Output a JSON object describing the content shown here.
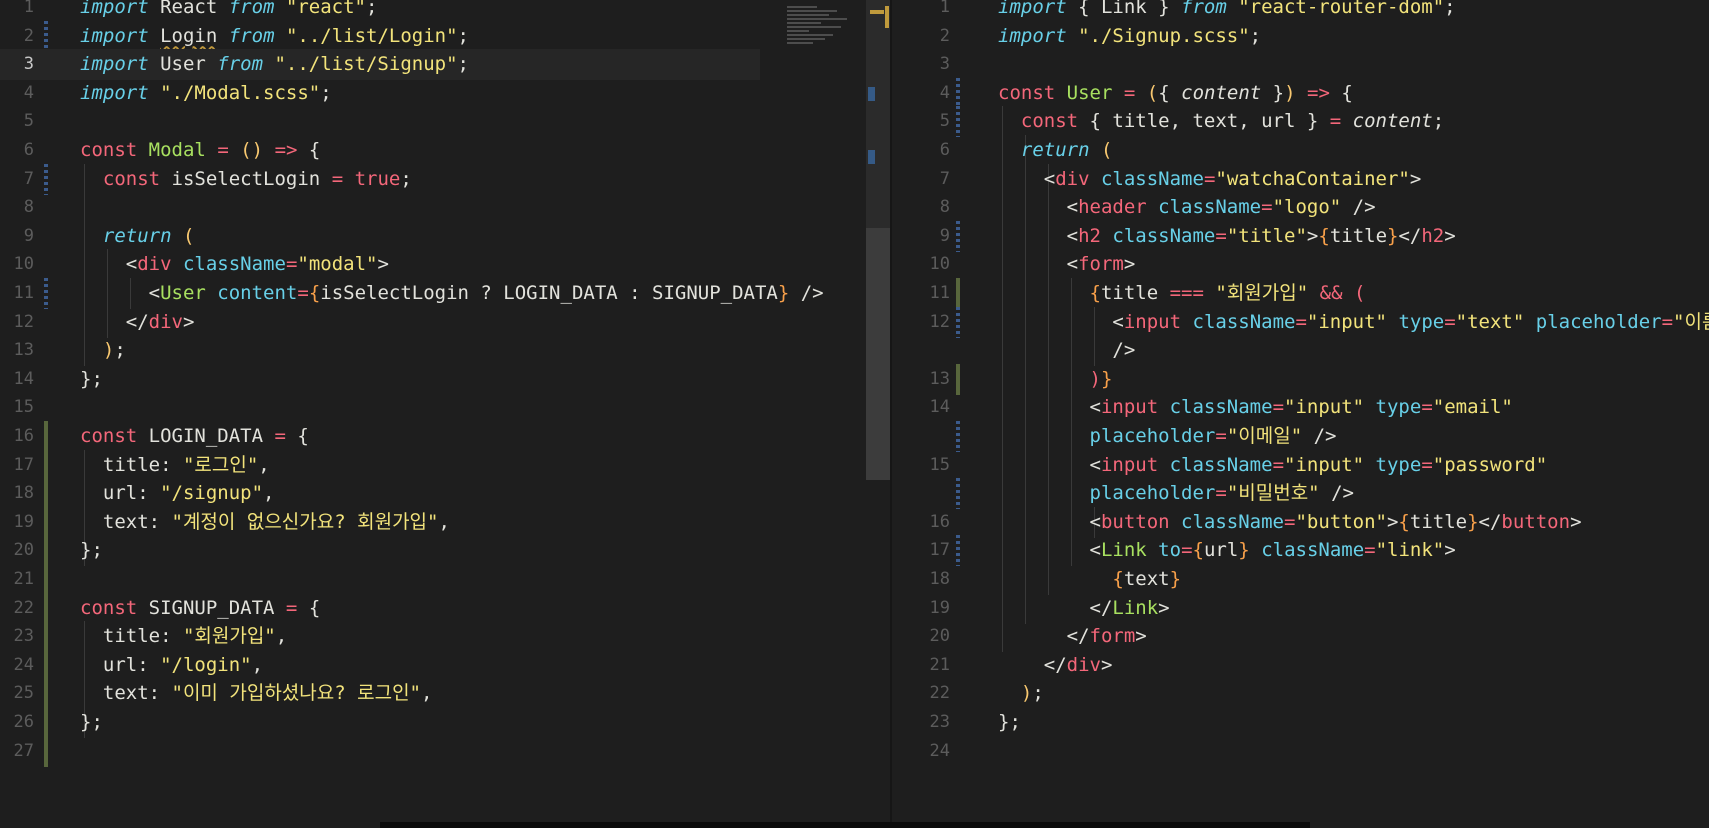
{
  "theme": {
    "keyword": "#f4677a",
    "italic_keyword": "#68d0e8",
    "string": "#f2e37b",
    "func": "#a8e060",
    "tag": "#f4677a",
    "attr": "#68d0e8",
    "paren": "#f8c870",
    "brace": "#f8a04a",
    "operator": "#f4677a",
    "plain": "#e2e2dc",
    "comment": "#6c6c6c"
  },
  "left_editor": {
    "lines": [
      {
        "n": "1",
        "tokens": [
          [
            "kwi",
            "import"
          ],
          [
            "p",
            " React "
          ],
          [
            "kwi",
            "from"
          ],
          [
            "s",
            " \"react\""
          ],
          [
            "p",
            ";"
          ]
        ]
      },
      {
        "n": "2",
        "tokens": [
          [
            "kwi",
            "import"
          ],
          [
            "p",
            " "
          ],
          [
            "sq",
            "Login"
          ],
          [
            "p",
            " "
          ],
          [
            "kwi",
            "from"
          ],
          [
            "s",
            " \"../list/Login\""
          ],
          [
            "p",
            ";"
          ]
        ]
      },
      {
        "n": "3",
        "tokens": [
          [
            "kwi",
            "import"
          ],
          [
            "p",
            " User "
          ],
          [
            "kwi",
            "from"
          ],
          [
            "s",
            " \"../list/Signup\""
          ],
          [
            "p",
            ";"
          ]
        ]
      },
      {
        "n": "4",
        "tokens": [
          [
            "kwi",
            "import"
          ],
          [
            "s",
            " \"./Modal.scss\""
          ],
          [
            "p",
            ";"
          ]
        ]
      },
      {
        "n": "5",
        "tokens": []
      },
      {
        "n": "6",
        "tokens": [
          [
            "kw",
            "const"
          ],
          [
            "p",
            " "
          ],
          [
            "fn",
            "Modal"
          ],
          [
            "p",
            " "
          ],
          [
            "op",
            "="
          ],
          [
            "p",
            " "
          ],
          [
            "par",
            "()"
          ],
          [
            "p",
            " "
          ],
          [
            "op",
            "=>"
          ],
          [
            "p",
            " {"
          ]
        ]
      },
      {
        "n": "7",
        "tokens": [
          [
            "p",
            "  "
          ],
          [
            "kw",
            "const"
          ],
          [
            "p",
            " isSelectLogin "
          ],
          [
            "op",
            "="
          ],
          [
            "p",
            " "
          ],
          [
            "kw",
            "true"
          ],
          [
            "p",
            ";"
          ]
        ]
      },
      {
        "n": "8",
        "tokens": []
      },
      {
        "n": "9",
        "tokens": [
          [
            "p",
            "  "
          ],
          [
            "kwi",
            "return"
          ],
          [
            "p",
            " "
          ],
          [
            "par",
            "("
          ]
        ]
      },
      {
        "n": "10",
        "tokens": [
          [
            "p",
            "    <"
          ],
          [
            "tag",
            "div"
          ],
          [
            "p",
            " "
          ],
          [
            "at",
            "className"
          ],
          [
            "op",
            "="
          ],
          [
            "s",
            "\"modal\""
          ],
          [
            "p",
            ">"
          ]
        ]
      },
      {
        "n": "11",
        "tokens": [
          [
            "p",
            "      <"
          ],
          [
            "fn",
            "User"
          ],
          [
            "p",
            " "
          ],
          [
            "at",
            "content"
          ],
          [
            "op",
            "="
          ],
          [
            "br",
            "{"
          ],
          [
            "p",
            "isSelectLogin ? LOGIN_DATA : SIGNUP_DATA"
          ],
          [
            "br",
            "}"
          ],
          [
            "p",
            " />"
          ]
        ]
      },
      {
        "n": "12",
        "tokens": [
          [
            "p",
            "    </"
          ],
          [
            "tag",
            "div"
          ],
          [
            "p",
            ">"
          ]
        ]
      },
      {
        "n": "13",
        "tokens": [
          [
            "p",
            "  "
          ],
          [
            "par",
            ")"
          ],
          [
            "p",
            ";"
          ]
        ]
      },
      {
        "n": "14",
        "tokens": [
          [
            "p",
            "};"
          ]
        ]
      },
      {
        "n": "15",
        "tokens": []
      },
      {
        "n": "16",
        "tokens": [
          [
            "kw",
            "const"
          ],
          [
            "p",
            " LOGIN_DATA "
          ],
          [
            "op",
            "="
          ],
          [
            "p",
            " {"
          ]
        ]
      },
      {
        "n": "17",
        "tokens": [
          [
            "p",
            "  title: "
          ],
          [
            "s",
            "\"로그인\""
          ],
          [
            "p",
            ","
          ]
        ]
      },
      {
        "n": "18",
        "tokens": [
          [
            "p",
            "  url: "
          ],
          [
            "s",
            "\"/signup\""
          ],
          [
            "p",
            ","
          ]
        ]
      },
      {
        "n": "19",
        "tokens": [
          [
            "p",
            "  text: "
          ],
          [
            "s",
            "\"계정이 없으신가요? 회원가입\""
          ],
          [
            "p",
            ","
          ]
        ]
      },
      {
        "n": "20",
        "tokens": [
          [
            "p",
            "};"
          ]
        ]
      },
      {
        "n": "21",
        "tokens": []
      },
      {
        "n": "22",
        "tokens": [
          [
            "kw",
            "const"
          ],
          [
            "p",
            " SIGNUP_DATA "
          ],
          [
            "op",
            "="
          ],
          [
            "p",
            " {"
          ]
        ]
      },
      {
        "n": "23",
        "tokens": [
          [
            "p",
            "  title: "
          ],
          [
            "s",
            "\"회원가입\""
          ],
          [
            "p",
            ","
          ]
        ]
      },
      {
        "n": "24",
        "tokens": [
          [
            "p",
            "  url: "
          ],
          [
            "s",
            "\"/login\""
          ],
          [
            "p",
            ","
          ]
        ]
      },
      {
        "n": "25",
        "tokens": [
          [
            "p",
            "  text: "
          ],
          [
            "s",
            "\"이미 가입하셨나요? 로그인\""
          ],
          [
            "p",
            ","
          ]
        ]
      },
      {
        "n": "26",
        "tokens": [
          [
            "p",
            "};"
          ]
        ]
      },
      {
        "n": "27",
        "tokens": []
      }
    ]
  },
  "right_editor": {
    "lines": [
      {
        "n": "1",
        "tokens": [
          [
            "kwi",
            "import"
          ],
          [
            "p",
            " { Link } "
          ],
          [
            "kwi",
            "from"
          ],
          [
            "s",
            " \"react-router-dom\""
          ],
          [
            "p",
            ";"
          ]
        ]
      },
      {
        "n": "2",
        "tokens": [
          [
            "kwi",
            "import"
          ],
          [
            "s",
            " \"./Signup.scss\""
          ],
          [
            "p",
            ";"
          ]
        ]
      },
      {
        "n": "3",
        "tokens": []
      },
      {
        "n": "4",
        "tokens": [
          [
            "kw",
            "const"
          ],
          [
            "p",
            " "
          ],
          [
            "fn",
            "User"
          ],
          [
            "p",
            " "
          ],
          [
            "op",
            "="
          ],
          [
            "p",
            " "
          ],
          [
            "par",
            "("
          ],
          [
            "p",
            "{ "
          ],
          [
            "it",
            "content"
          ],
          [
            "p",
            " }"
          ],
          [
            "par",
            ")"
          ],
          [
            "p",
            " "
          ],
          [
            "op",
            "=>"
          ],
          [
            "p",
            " {"
          ]
        ]
      },
      {
        "n": "5",
        "tokens": [
          [
            "p",
            "  "
          ],
          [
            "kw",
            "const"
          ],
          [
            "p",
            " { title, text, url } "
          ],
          [
            "op",
            "="
          ],
          [
            "p",
            " "
          ],
          [
            "it",
            "content"
          ],
          [
            "p",
            ";"
          ]
        ]
      },
      {
        "n": "6",
        "tokens": [
          [
            "p",
            "  "
          ],
          [
            "kwi",
            "return"
          ],
          [
            "p",
            " "
          ],
          [
            "par",
            "("
          ]
        ]
      },
      {
        "n": "7",
        "tokens": [
          [
            "p",
            "    <"
          ],
          [
            "tag",
            "div"
          ],
          [
            "p",
            " "
          ],
          [
            "at",
            "className"
          ],
          [
            "op",
            "="
          ],
          [
            "s",
            "\"watchaContainer\""
          ],
          [
            "p",
            ">"
          ]
        ]
      },
      {
        "n": "8",
        "tokens": [
          [
            "p",
            "      <"
          ],
          [
            "tag",
            "header"
          ],
          [
            "p",
            " "
          ],
          [
            "at",
            "className"
          ],
          [
            "op",
            "="
          ],
          [
            "s",
            "\"logo\""
          ],
          [
            "p",
            " />"
          ]
        ]
      },
      {
        "n": "9",
        "tokens": [
          [
            "p",
            "      <"
          ],
          [
            "tag",
            "h2"
          ],
          [
            "p",
            " "
          ],
          [
            "at",
            "className"
          ],
          [
            "op",
            "="
          ],
          [
            "s",
            "\"title\""
          ],
          [
            "p",
            ">"
          ],
          [
            "br",
            "{"
          ],
          [
            "p",
            "title"
          ],
          [
            "br",
            "}"
          ],
          [
            "p",
            "</"
          ],
          [
            "tag",
            "h2"
          ],
          [
            "p",
            ">"
          ]
        ]
      },
      {
        "n": "10",
        "tokens": [
          [
            "p",
            "      <"
          ],
          [
            "tag",
            "form"
          ],
          [
            "p",
            ">"
          ]
        ]
      },
      {
        "n": "11",
        "tokens": [
          [
            "p",
            "        "
          ],
          [
            "br",
            "{"
          ],
          [
            "p",
            "title "
          ],
          [
            "op",
            "==="
          ],
          [
            "s",
            " \"회원가입\""
          ],
          [
            "p",
            " "
          ],
          [
            "op",
            "&&"
          ],
          [
            "p",
            " "
          ],
          [
            "kw",
            "("
          ]
        ]
      },
      {
        "n": "12",
        "tokens": [
          [
            "p",
            "          <"
          ],
          [
            "tag",
            "input"
          ],
          [
            "p",
            " "
          ],
          [
            "at",
            "className"
          ],
          [
            "op",
            "="
          ],
          [
            "s",
            "\"input\""
          ],
          [
            "p",
            " "
          ],
          [
            "at",
            "type"
          ],
          [
            "op",
            "="
          ],
          [
            "s",
            "\"text\""
          ],
          [
            "p",
            " "
          ],
          [
            "at",
            "placeholder"
          ],
          [
            "op",
            "="
          ],
          [
            "s",
            "\"이름\""
          ]
        ]
      },
      {
        "n": "",
        "tokens": [
          [
            "p",
            "          />"
          ]
        ]
      },
      {
        "n": "13",
        "tokens": [
          [
            "p",
            "        "
          ],
          [
            "kw",
            ")"
          ],
          [
            "br",
            "}"
          ]
        ]
      },
      {
        "n": "14",
        "tokens": [
          [
            "p",
            "        <"
          ],
          [
            "tag",
            "input"
          ],
          [
            "p",
            " "
          ],
          [
            "at",
            "className"
          ],
          [
            "op",
            "="
          ],
          [
            "s",
            "\"input\""
          ],
          [
            "p",
            " "
          ],
          [
            "at",
            "type"
          ],
          [
            "op",
            "="
          ],
          [
            "s",
            "\"email\""
          ]
        ]
      },
      {
        "n": "",
        "tokens": [
          [
            "p",
            "        "
          ],
          [
            "at",
            "placeholder"
          ],
          [
            "op",
            "="
          ],
          [
            "s",
            "\"이메일\""
          ],
          [
            "p",
            " />"
          ]
        ]
      },
      {
        "n": "15",
        "tokens": [
          [
            "p",
            "        <"
          ],
          [
            "tag",
            "input"
          ],
          [
            "p",
            " "
          ],
          [
            "at",
            "className"
          ],
          [
            "op",
            "="
          ],
          [
            "s",
            "\"input\""
          ],
          [
            "p",
            " "
          ],
          [
            "at",
            "type"
          ],
          [
            "op",
            "="
          ],
          [
            "s",
            "\"password\""
          ]
        ]
      },
      {
        "n": "",
        "tokens": [
          [
            "p",
            "        "
          ],
          [
            "at",
            "placeholder"
          ],
          [
            "op",
            "="
          ],
          [
            "s",
            "\"비밀번호\""
          ],
          [
            "p",
            " />"
          ]
        ]
      },
      {
        "n": "16",
        "tokens": [
          [
            "p",
            "        <"
          ],
          [
            "tag",
            "button"
          ],
          [
            "p",
            " "
          ],
          [
            "at",
            "className"
          ],
          [
            "op",
            "="
          ],
          [
            "s",
            "\"button\""
          ],
          [
            "p",
            ">"
          ],
          [
            "br",
            "{"
          ],
          [
            "p",
            "title"
          ],
          [
            "br",
            "}"
          ],
          [
            "p",
            "</"
          ],
          [
            "tag",
            "button"
          ],
          [
            "p",
            ">"
          ]
        ]
      },
      {
        "n": "17",
        "tokens": [
          [
            "p",
            "        <"
          ],
          [
            "fn",
            "Link"
          ],
          [
            "p",
            " "
          ],
          [
            "at",
            "to"
          ],
          [
            "op",
            "="
          ],
          [
            "br",
            "{"
          ],
          [
            "p",
            "url"
          ],
          [
            "br",
            "}"
          ],
          [
            "p",
            " "
          ],
          [
            "at",
            "className"
          ],
          [
            "op",
            "="
          ],
          [
            "s",
            "\"link\""
          ],
          [
            "p",
            ">"
          ]
        ]
      },
      {
        "n": "18",
        "tokens": [
          [
            "p",
            "          "
          ],
          [
            "br",
            "{"
          ],
          [
            "p",
            "text"
          ],
          [
            "br",
            "}"
          ]
        ]
      },
      {
        "n": "19",
        "tokens": [
          [
            "p",
            "        </"
          ],
          [
            "fn",
            "Link"
          ],
          [
            "p",
            ">"
          ]
        ]
      },
      {
        "n": "20",
        "tokens": [
          [
            "p",
            "      </"
          ],
          [
            "tag",
            "form"
          ],
          [
            "p",
            ">"
          ]
        ]
      },
      {
        "n": "21",
        "tokens": [
          [
            "p",
            "    </"
          ],
          [
            "tag",
            "div"
          ],
          [
            "p",
            ">"
          ]
        ]
      },
      {
        "n": "22",
        "tokens": [
          [
            "p",
            "  "
          ],
          [
            "par",
            ")"
          ],
          [
            "p",
            ";"
          ]
        ]
      },
      {
        "n": "23",
        "tokens": [
          [
            "p",
            "};"
          ]
        ]
      },
      {
        "n": "24",
        "tokens": []
      }
    ]
  }
}
